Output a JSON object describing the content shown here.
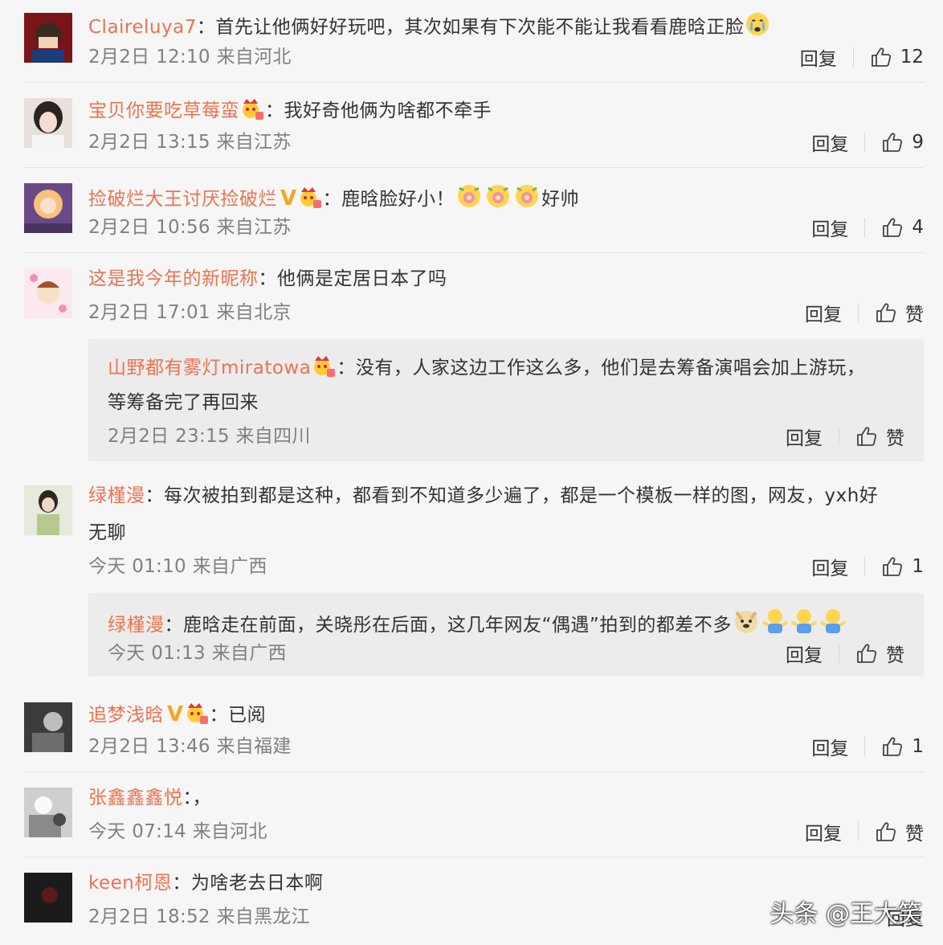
{
  "comments": [
    {
      "user": "Claireluya7",
      "text": "：首先让他俩好好玩吧，其次如果有下次能不能让我看看鹿晗正脸",
      "meta": "2月2日 12:10 来自河北",
      "reply": "回复",
      "likes": "12"
    },
    {
      "user": "宝贝你要吃草莓蛮",
      "text": "：我好奇他俩为啥都不牵手",
      "meta": "2月2日 13:15 来自江苏",
      "reply": "回复",
      "likes": "9"
    },
    {
      "user": "捡破烂大王讨厌捡破烂",
      "text": "：鹿晗脸好小！",
      "text2": "好帅",
      "meta": "2月2日 10:56 来自江苏",
      "reply": "回复",
      "likes": "4"
    },
    {
      "user": "这是我今年的新昵称",
      "text": "：他俩是定居日本了吗",
      "meta": "2月2日 17:01 来自北京",
      "reply": "回复",
      "likes": "赞"
    },
    {
      "user": "绿槿漫",
      "text": "：每次被拍到都是这种，都看到不知道多少遍了，都是一个模板一样的图，网友，yxh好",
      "text_line2": "无聊",
      "meta": "今天 01:10 来自广西",
      "reply": "回复",
      "likes": "1"
    },
    {
      "user": "追梦浅晗",
      "text": "：已阅",
      "meta": "2月2日 13:46 来自福建",
      "reply": "回复",
      "likes": "1"
    },
    {
      "user": "张鑫鑫鑫悦",
      "text": "：，",
      "meta": "今天 07:14 来自河北",
      "reply": "回复",
      "likes": "赞"
    },
    {
      "user": "keen柯恩",
      "text": "：为啥老去日本啊",
      "meta": "2月2日 18:52 来自黑龙江",
      "reply": "回复",
      "likes": ""
    }
  ],
  "replies": [
    {
      "user": "山野都有雾灯miratowa",
      "text": "：没有，人家这边工作这么多，他们是去筹备演唱会加上游玩，",
      "text_line2": "等筹备完了再回来",
      "meta": "2月2日 23:15 来自四川",
      "reply": "回复",
      "likes": "赞"
    },
    {
      "user": "绿槿漫",
      "text": "：鹿晗走在前面，关晓彤在后面，这几年网友“偶遇”拍到的都差不多",
      "meta": "今天 01:13 来自广西",
      "reply": "回复",
      "likes": "赞"
    }
  ],
  "badges": {
    "verified": "V"
  },
  "watermark": "头条 @王大笑",
  "colors": {
    "username": "#eb7350",
    "meta": "#808080",
    "background": "#f6f6f6",
    "reply_box": "#ececec"
  }
}
